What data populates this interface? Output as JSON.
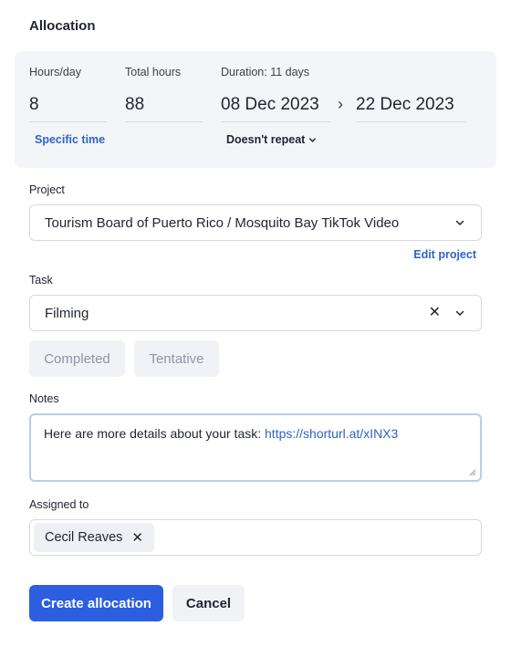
{
  "header": {
    "title": "Allocation"
  },
  "schedule": {
    "hours_day_label": "Hours/day",
    "hours_day_value": "8",
    "total_hours_label": "Total hours",
    "total_hours_value": "88",
    "duration_label": "Duration: 11 days",
    "start_date": "08 Dec 2023",
    "end_date": "22 Dec 2023",
    "specific_time_link": "Specific time",
    "repeat_label": "Doesn't repeat"
  },
  "project": {
    "label": "Project",
    "value": "Tourism Board of Puerto Rico / Mosquito Bay TikTok Video",
    "edit_link": "Edit project"
  },
  "task": {
    "label": "Task",
    "value": "Filming",
    "completed_label": "Completed",
    "tentative_label": "Tentative"
  },
  "notes": {
    "label": "Notes",
    "text": "Here are more details about your task: ",
    "link": "https://shorturl.at/xINX3"
  },
  "assigned": {
    "label": "Assigned to",
    "people": [
      "Cecil Reaves"
    ]
  },
  "actions": {
    "create_label": "Create allocation",
    "cancel_label": "Cancel"
  },
  "colors": {
    "accent": "#2b5fe0",
    "link": "#2f62c9",
    "panel_bg": "#f4f5f8"
  },
  "icons": {
    "arrow": "chevron-right-icon",
    "dropdown": "chevron-down-icon",
    "clear": "close-icon",
    "remove_chip": "close-icon"
  }
}
